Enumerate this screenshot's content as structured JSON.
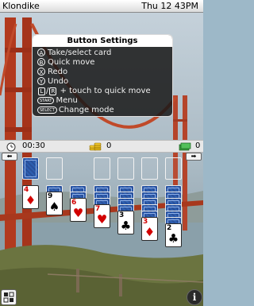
{
  "app": {
    "title": "Klondike",
    "clock": "Thu 12 43PM"
  },
  "menu": {
    "title": "Button Settings",
    "rows": [
      {
        "glyph": "A",
        "label": "Take/select card"
      },
      {
        "glyph": "B",
        "label": "Quick move"
      },
      {
        "glyph": "X",
        "label": "Redo"
      },
      {
        "glyph": "Y",
        "label": "Undo"
      },
      {
        "glyph_l": "L",
        "sep": "/",
        "glyph_r": "R",
        "label": "+ touch to quick move"
      },
      {
        "glyph": "START",
        "label": "Menu"
      },
      {
        "glyph": "SELECT",
        "label": "Change mode"
      }
    ]
  },
  "status": {
    "time": "00:30",
    "score": "0",
    "moves": "0"
  },
  "colors": {
    "red": "#d20000",
    "black": "#000000",
    "card_back": "#2d5fb0"
  },
  "icons": [
    "clock-icon",
    "coins-icon",
    "cash-icon",
    "left-arrow-icon",
    "right-arrow-icon",
    "shuffle-icon",
    "info-icon"
  ],
  "tableau": [
    {
      "face_down": 0,
      "rank": "4",
      "suit": "♦",
      "color": "red"
    },
    {
      "face_down": 1,
      "rank": "9",
      "suit": "♠",
      "color": "black"
    },
    {
      "face_down": 2,
      "rank": "6",
      "suit": "♥",
      "color": "red"
    },
    {
      "face_down": 3,
      "rank": "7",
      "suit": "♥",
      "color": "red"
    },
    {
      "face_down": 4,
      "rank": "3",
      "suit": "♣",
      "color": "black"
    },
    {
      "face_down": 5,
      "rank": "3",
      "suit": "♦",
      "color": "red"
    },
    {
      "face_down": 6,
      "rank": "2",
      "suit": "♣",
      "color": "black"
    }
  ]
}
